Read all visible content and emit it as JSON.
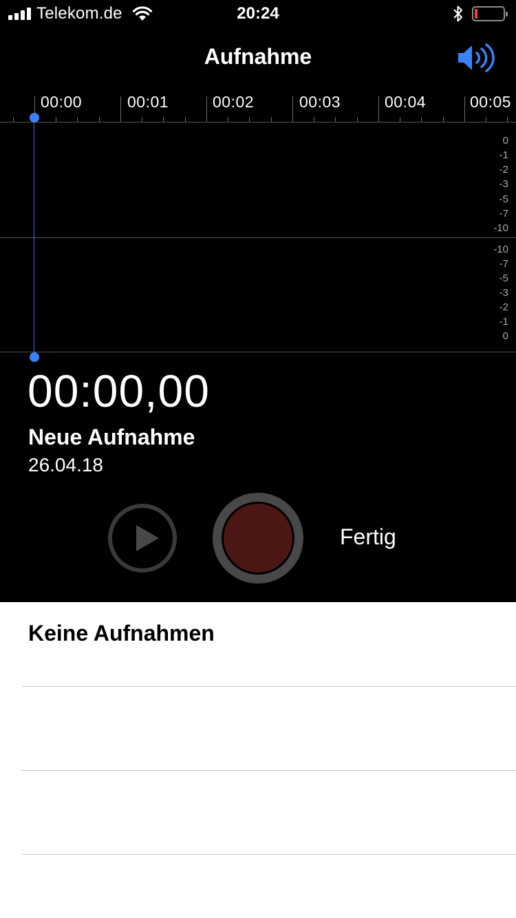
{
  "status_bar": {
    "carrier": "Telekom.de",
    "time": "20:24",
    "battery_level": 0.1,
    "signal_bars": 4
  },
  "nav": {
    "title": "Aufnahme",
    "speaker_icon": "speaker-volume-icon",
    "accent_color": "#3b82f6"
  },
  "timeline": {
    "labels": [
      "00:00",
      "00:01",
      "00:02",
      "00:03",
      "00:04",
      "00:05"
    ]
  },
  "level_scale": {
    "top": [
      "0",
      "-1",
      "-2",
      "-3",
      "-5",
      "-7",
      "-10"
    ],
    "bottom": [
      "-10",
      "-7",
      "-5",
      "-3",
      "-2",
      "-1",
      "0"
    ]
  },
  "recording": {
    "elapsed": "00:00,00",
    "name": "Neue Aufnahme",
    "date": "26.04.18"
  },
  "controls": {
    "play_icon": "play-icon",
    "record_icon": "record-icon",
    "done_label": "Fertig"
  },
  "list": {
    "empty_label": "Keine Aufnahmen"
  }
}
